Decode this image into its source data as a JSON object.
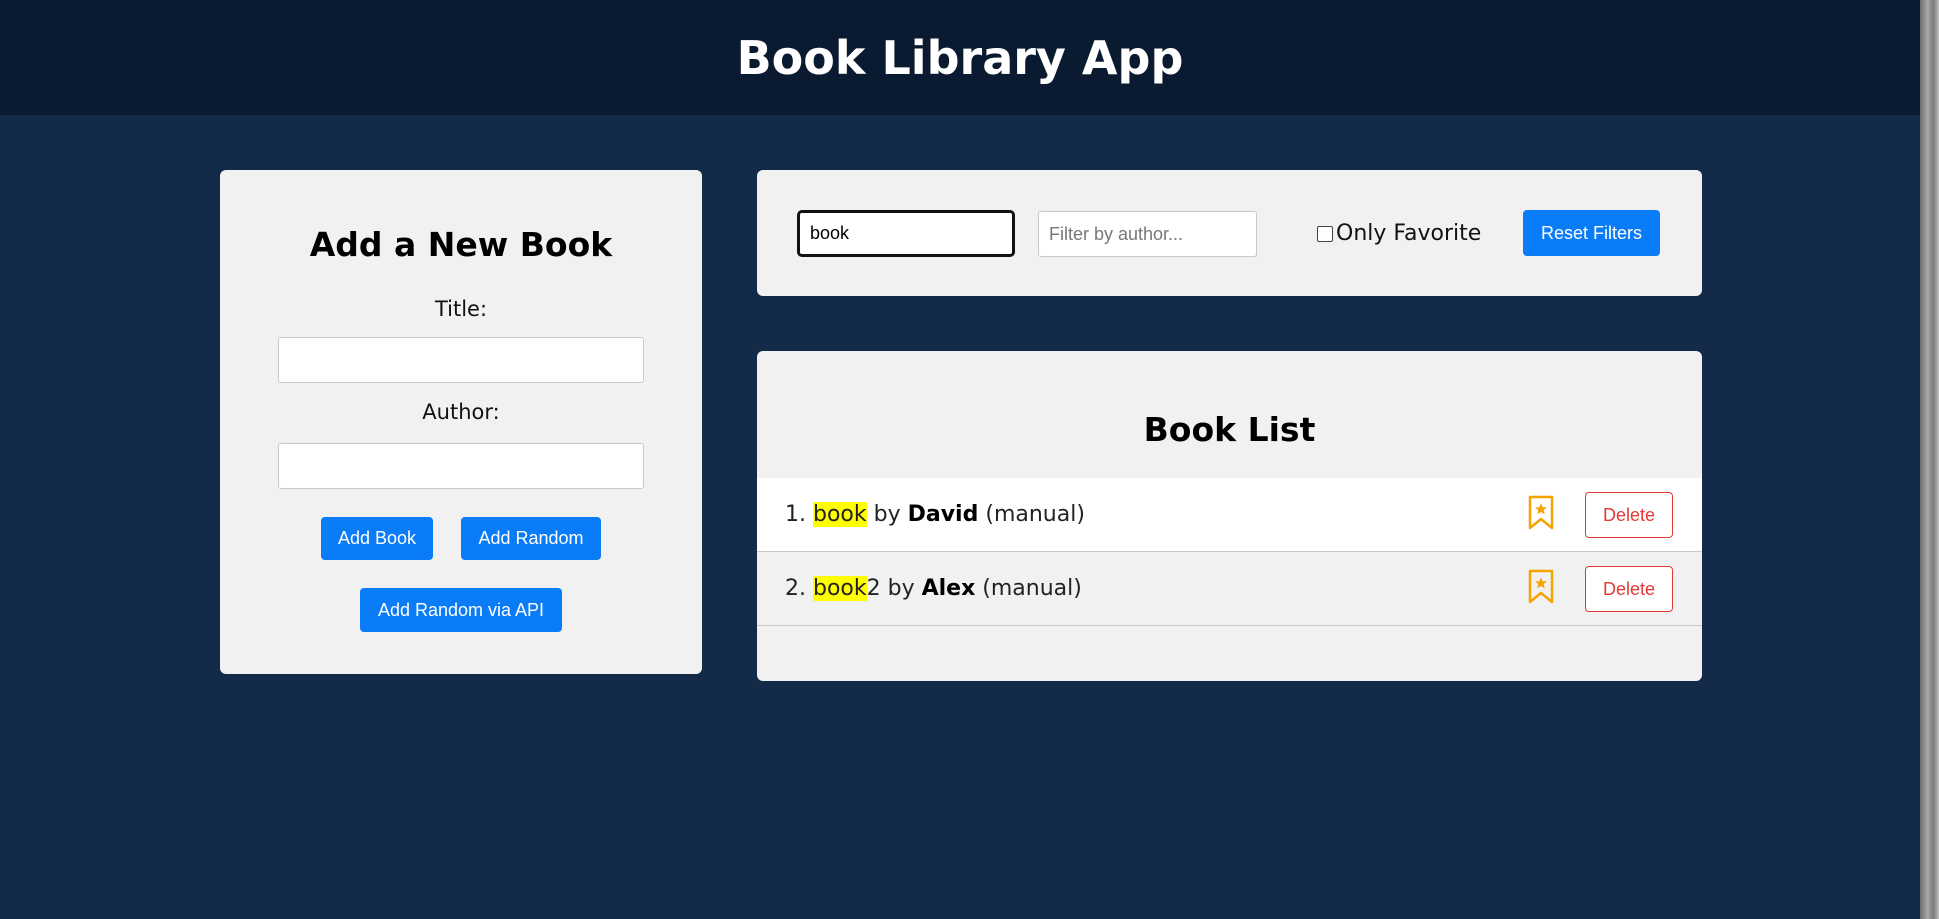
{
  "app": {
    "title": "Book Library App"
  },
  "add_form": {
    "heading": "Add a New Book",
    "title_label": "Title:",
    "title_value": "",
    "author_label": "Author:",
    "author_value": "",
    "add_button": "Add Book",
    "add_random_button": "Add Random",
    "add_random_api_button": "Add Random via API"
  },
  "filters": {
    "search_value": "book",
    "author_placeholder": "Filter by author...",
    "author_value": "",
    "only_favorite_label": "Only Favorite",
    "only_favorite_checked": false,
    "reset_button": "Reset Filters"
  },
  "book_list": {
    "heading": "Book List",
    "highlight_color": "#ffff00",
    "items": [
      {
        "number": "1.",
        "title_match": "book",
        "title_rest": "",
        "by": "by",
        "author": "David",
        "source": "(manual)",
        "bookmark_icon": "bookmark-star-icon",
        "delete_label": "Delete"
      },
      {
        "number": "2.",
        "title_match": "book",
        "title_rest": "2",
        "by": "by",
        "author": "Alex",
        "source": "(manual)",
        "bookmark_icon": "bookmark-star-icon",
        "delete_label": "Delete"
      }
    ]
  },
  "colors": {
    "header_bg": "#0a1b31",
    "page_bg": "#132b49",
    "panel_bg": "#f1f1f1",
    "primary_button": "#0a7cf7",
    "delete": "#e53935",
    "bookmark": "#f5a300"
  }
}
